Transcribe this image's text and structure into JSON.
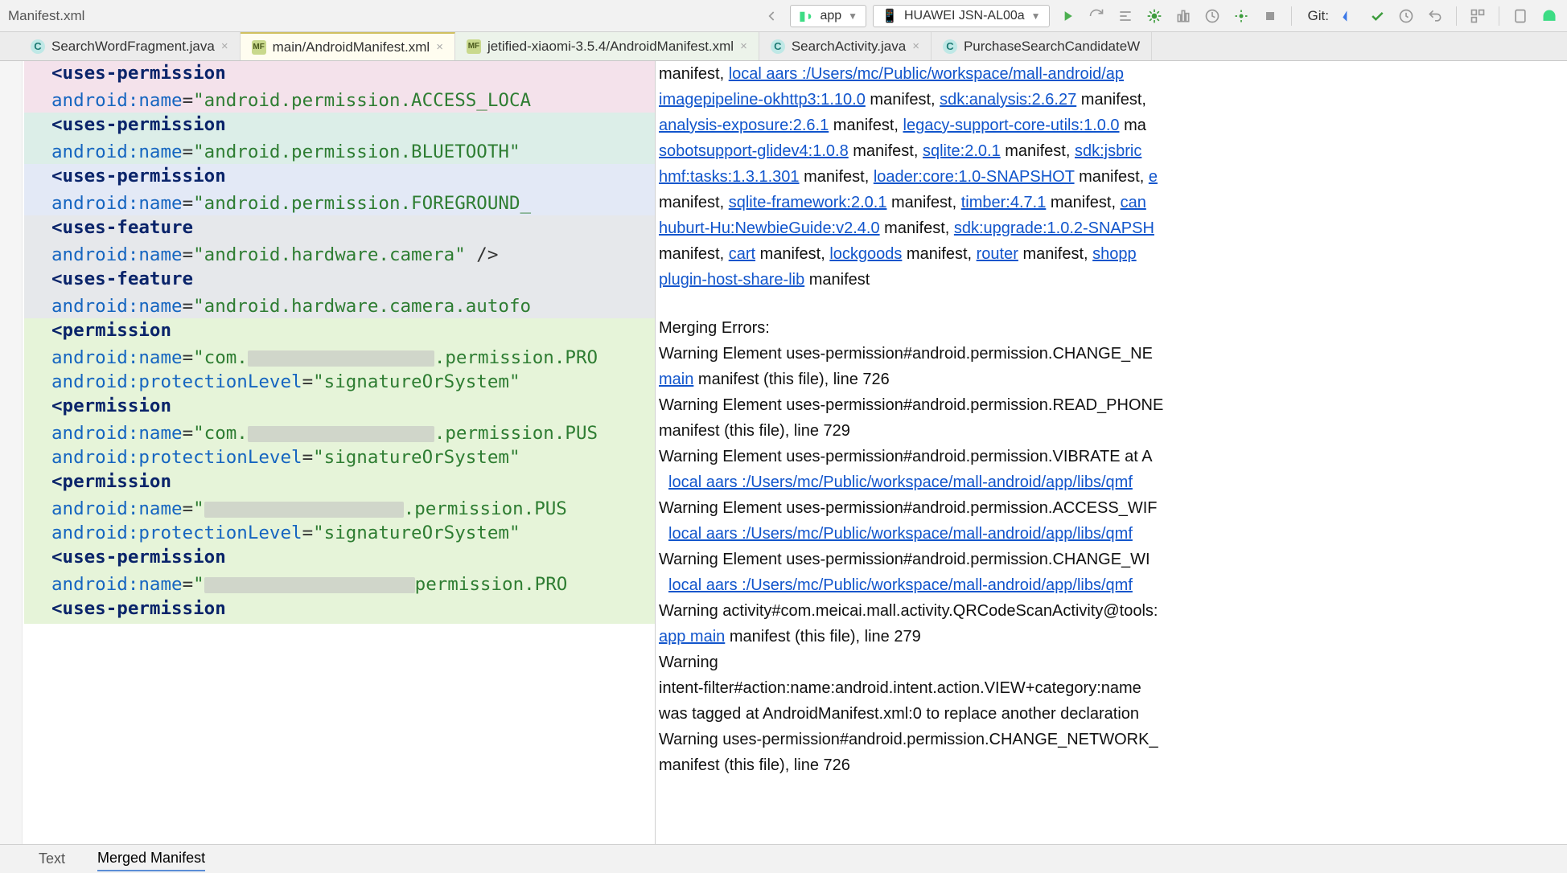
{
  "toolbar": {
    "file": "Manifest.xml",
    "module": "app",
    "device": "HUAWEI JSN-AL00a",
    "git_label": "Git:"
  },
  "tabs": [
    {
      "label": "SearchWordFragment.java",
      "icon": "c"
    },
    {
      "label": "main/AndroidManifest.xml",
      "icon": "m"
    },
    {
      "label": "jetified-xiaomi-3.5.4/AndroidManifest.xml",
      "icon": "m"
    },
    {
      "label": "SearchActivity.java",
      "icon": "c"
    },
    {
      "label": "PurchaseSearchCandidateW",
      "icon": "c"
    }
  ],
  "code": {
    "uses_perm": "<uses-permission",
    "uses_feat": "<uses-feature",
    "perm": "<permission",
    "a_name": "android:name",
    "a_prot": "android:protectionLevel",
    "close_self": " />",
    "v_access_loc": "\"android.permission.ACCESS_LOCA",
    "v_bluetooth": "\"android.permission.BLUETOOTH\"",
    "v_foreground": "\"android.permission.FOREGROUND_",
    "v_hw_camera": "\"android.hardware.camera\"",
    "v_hw_autofocus": "\"android.hardware.camera.autofo",
    "v_protlevel": "\"signatureOrSystem\"",
    "v_perm_pro": ".permission.PRO",
    "v_perm_pus": ".permission.PUS",
    "v_perm_pus2": ".permission.PUS",
    "v_perm_pro2": "permission.PRO",
    "v_com_pref": "\"com."
  },
  "merged": {
    "l1_pre": "manifest, ",
    "l1_a": " local aars  :/Users/mc/Public/workspace/mall-android/ap",
    "l2_a": "imagepipeline-okhttp3:1.10.0",
    "l2_b": " manifest, ",
    "l2_c": "sdk:analysis:2.6.27",
    "l2_d": " manifest,",
    "l3_a": "analysis-exposure:2.6.1",
    "l3_b": " manifest, ",
    "l3_c": "legacy-support-core-utils:1.0.0",
    "l3_d": " ma",
    "l4_a": "sobotsupport-glidev4:1.0.8",
    "l4_b": " manifest, ",
    "l4_c": "sqlite:2.0.1",
    "l4_d": " manifest, ",
    "l4_e": "sdk:jsbric",
    "l5_a": "hmf:tasks:1.3.1.301",
    "l5_b": " manifest, ",
    "l5_c": "loader:core:1.0-SNAPSHOT",
    "l5_d": " manifest, ",
    "l5_e": "e",
    "l6_a": "manifest, ",
    "l6_b": "sqlite-framework:2.0.1",
    "l6_c": " manifest, ",
    "l6_d": "timber:4.7.1",
    "l6_e": " manifest, ",
    "l6_f": "can",
    "l7_a": "huburt-Hu:NewbieGuide:v2.4.0",
    "l7_b": " manifest, ",
    "l7_c": "sdk:upgrade:1.0.2-SNAPSH",
    "l8_a": "manifest, ",
    "l8_b": "cart",
    "l8_c": " manifest, ",
    "l8_d": "lockgoods",
    "l8_e": " manifest, ",
    "l8_f": "router",
    "l8_g": " manifest, ",
    "l8_h": "shopp",
    "l9_a": "plugin-host-share-lib",
    "l9_b": " manifest",
    "errhdr": "Merging Errors:",
    "w1": "Warning Element uses-permission#android.permission.CHANGE_NE",
    "w1b_a": "main",
    "w1b_b": " manifest (this file), line 726",
    "w2": "Warning Element uses-permission#android.permission.READ_PHONE",
    "w2b": "manifest (this file), line 729",
    "w3": "Warning Element uses-permission#android.permission.VIBRATE at A",
    "aars": " local aars  :/Users/mc/Public/workspace/mall-android/app/libs/qmf",
    "w4": "Warning Element uses-permission#android.permission.ACCESS_WIF",
    "w5": "Warning Element uses-permission#android.permission.CHANGE_WI",
    "w6": "Warning activity#com.meicai.mall.activity.QRCodeScanActivity@tools:",
    "w6b_a": "app main",
    "w6b_b": " manifest (this file), line 279",
    "w7": "Warning",
    "w7b": "intent-filter#action:name:android.intent.action.VIEW+category:name",
    "w7c": "was tagged at AndroidManifest.xml:0 to replace another declaration ",
    "w8": "Warning uses-permission#android.permission.CHANGE_NETWORK_",
    "w8b": "manifest (this file), line 726"
  },
  "bottom": {
    "text_tab": "Text",
    "merged_tab": "Merged Manifest"
  }
}
